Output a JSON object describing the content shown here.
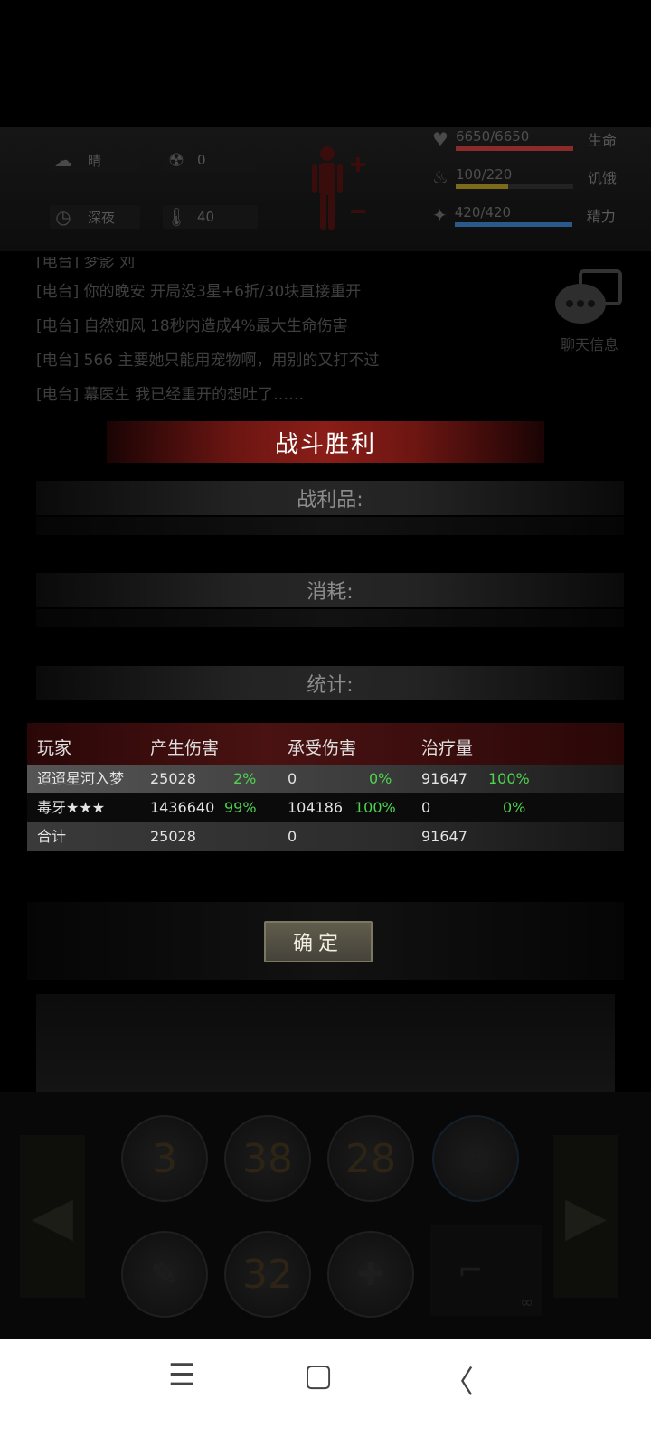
{
  "status": {
    "weather": "晴",
    "radiation": "0",
    "time_of_day": "深夜",
    "temperature": "40",
    "hp": {
      "value": "6650/6650",
      "label": "生命",
      "fill": 1.0,
      "color": "#8a2a2a"
    },
    "hunger": {
      "value": "100/220",
      "label": "饥饿",
      "fill": 0.45,
      "color": "#7a6a1a"
    },
    "energy": {
      "value": "420/420",
      "label": "精力",
      "fill": 1.0,
      "color": "#2a5a8a"
    }
  },
  "chat": {
    "lines": [
      "[电台] 梦影 刘",
      "[电台] 你的晚安 开局没3星+6折/30块直接重开",
      "[电台] 自然如风 18秒内造成4%最大生命伤害",
      "[电台] 566 主要她只能用宠物啊，用别的又打不过",
      "[电台] 幕医生 我已经重开的想吐了……"
    ],
    "button_label": "聊天信息"
  },
  "result": {
    "title": "战斗胜利",
    "loot_label": "战利品:",
    "consume_label": "消耗:",
    "stats_label": "统计:",
    "columns": [
      "玩家",
      "产生伤害",
      "承受伤害",
      "治疗量"
    ],
    "rows": [
      {
        "player": "迢迢星河入梦",
        "dealt": "25028",
        "dealt_pct": "2%",
        "taken": "0",
        "taken_pct": "0%",
        "heal": "91647",
        "heal_pct": "100%"
      },
      {
        "player": "毒牙★★★",
        "dealt": "1436640",
        "dealt_pct": "99%",
        "taken": "104186",
        "taken_pct": "100%",
        "heal": "0",
        "heal_pct": "0%"
      }
    ],
    "total": {
      "label": "合计",
      "dealt": "25028",
      "taken": "0",
      "heal": "91647"
    },
    "confirm_label": "确定"
  },
  "skills": {
    "row1": [
      "3",
      "38",
      "28",
      ""
    ],
    "row2": [
      "",
      "32",
      ""
    ],
    "ammo": "∞"
  },
  "nav": {
    "menu": "☰",
    "home": "▢",
    "back": "〈"
  }
}
